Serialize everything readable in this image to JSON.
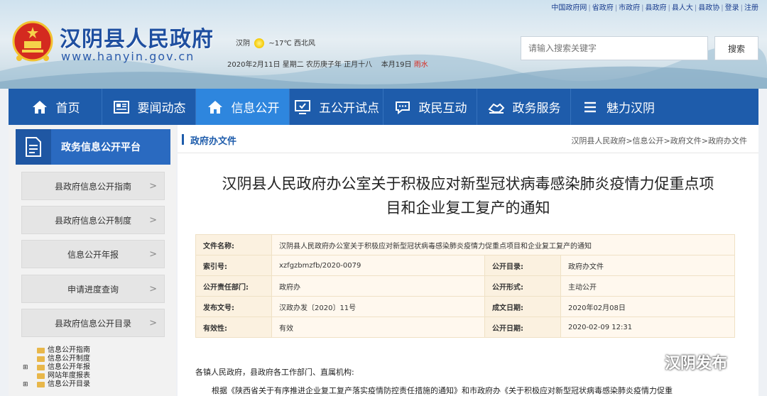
{
  "toplinks": [
    "中国政府网",
    "省政府",
    "市政府",
    "县政府",
    "县人大",
    "县政协",
    "登录",
    "注册"
  ],
  "site": {
    "title": "汉阴县人民政府",
    "url": "www.hanyin.gov.cn"
  },
  "weather": {
    "city": "汉阴",
    "temp": "~17℃",
    "wind": "西北风"
  },
  "dateline": {
    "date": "2020年2月11日 星期二 农历庚子年 正月十八",
    "weeks": "本月19日",
    "highlight": "雨水"
  },
  "search": {
    "placeholder": "请输入搜索关键字",
    "button": "搜索"
  },
  "nav": [
    {
      "label": "首页",
      "icon": "home-icon"
    },
    {
      "label": "要闻动态",
      "icon": "news-icon"
    },
    {
      "label": "信息公开",
      "icon": "home-icon",
      "active": true
    },
    {
      "label": "五公开试点",
      "icon": "monitor-icon"
    },
    {
      "label": "政民互动",
      "icon": "chat-icon"
    },
    {
      "label": "政务服务",
      "icon": "handshake-icon"
    },
    {
      "label": "魅力汉阴",
      "icon": "menu-icon"
    }
  ],
  "sidebar": {
    "platform_title": "政务信息公开平台",
    "items": [
      {
        "label": "县政府信息公开指南"
      },
      {
        "label": "县政府信息公开制度"
      },
      {
        "label": "信息公开年报"
      },
      {
        "label": "申请进度查询"
      },
      {
        "label": "县政府信息公开目录"
      }
    ],
    "tree": [
      {
        "label": "信息公开指南",
        "expandable": false
      },
      {
        "label": "信息公开制度",
        "expandable": false
      },
      {
        "label": "信息公开年报",
        "expandable": true
      },
      {
        "label": "网站年度报表",
        "expandable": false
      },
      {
        "label": "信息公开目录",
        "expandable": true
      }
    ]
  },
  "main": {
    "section_title": "政府办文件",
    "breadcrumb": "汉阴县人民政府>信息公开>政府文件>政府办文件",
    "doc_title_line1": "汉阴县人民政府办公室关于积极应对新型冠状病毒感染肺炎疫情力促重点项",
    "doc_title_line2": "目和企业复工复产的通知",
    "meta": {
      "name_label": "文件名称:",
      "name_value": "汉阴县人民政府办公室关于积极应对新型冠状病毒感染肺炎疫情力促重点项目和企业复工复产的通知",
      "rows": [
        {
          "k1": "索引号:",
          "v1": "xzfgzbmzfb/2020-0079",
          "k2": "公开目录:",
          "v2": "政府办文件"
        },
        {
          "k1": "公开责任部门:",
          "v1": "政府办",
          "k2": "公开形式:",
          "v2": "主动公开"
        },
        {
          "k1": "发布文号:",
          "v1": "汉政办发〔2020〕11号",
          "k2": "成文日期:",
          "v2": "2020年02月08日"
        },
        {
          "k1": "有效性:",
          "v1": "有效",
          "k2": "公开日期:",
          "v2": "2020-02-09 12:31"
        }
      ]
    },
    "greeting": "各镇人民政府，县政府各工作部门、直属机构:",
    "paragraph": "根据《陕西省关于有序推进企业复工复产落实疫情防控责任措施的通知》和市政府办《关于积极应对新型冠状病毒感染肺炎疫情力促重"
  },
  "watermark": "汉阴发布"
}
